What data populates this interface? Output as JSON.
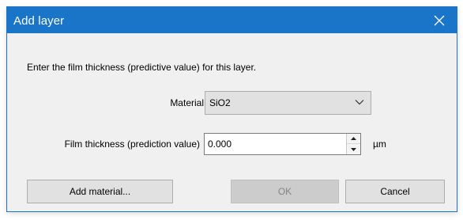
{
  "window": {
    "title": "Add layer",
    "close_icon": "close-icon"
  },
  "instruction": "Enter the film thickness (predictive value) for this layer.",
  "material": {
    "label": "Material",
    "selected": "SiO2",
    "dropdown_icon": "chevron-down-icon"
  },
  "thickness": {
    "label": "Film thickness (prediction value)",
    "value": "0.000",
    "unit": "µm",
    "spinner_icons": [
      "spin-up-icon",
      "spin-down-icon"
    ]
  },
  "buttons": {
    "add_material": "Add material...",
    "ok": "OK",
    "cancel": "Cancel"
  },
  "colors": {
    "titlebar": "#1a74c8",
    "dialog_bg": "#f0f0f0",
    "button_bg": "#e1e1e1",
    "disabled_text": "#838383"
  }
}
